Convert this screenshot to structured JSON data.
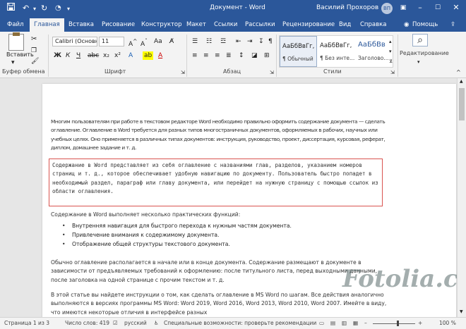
{
  "titlebar": {
    "doc_title": "Документ  -  Word",
    "user_name": "Василий Прохоров",
    "avatar_initials": "ВП",
    "icons": [
      "save-icon",
      "undo-icon",
      "redo-icon",
      "autosave-icon",
      "customize-icon"
    ],
    "window_buttons": [
      "ribbon-display-icon",
      "minimize-icon",
      "maximize-icon",
      "close-icon"
    ]
  },
  "tabs": [
    {
      "label": "Файл"
    },
    {
      "label": "Главная",
      "active": true
    },
    {
      "label": "Вставка"
    },
    {
      "label": "Рисование"
    },
    {
      "label": "Конструктор"
    },
    {
      "label": "Макет"
    },
    {
      "label": "Ссылки"
    },
    {
      "label": "Рассылки"
    },
    {
      "label": "Рецензирование"
    },
    {
      "label": "Вид"
    },
    {
      "label": "Справка"
    }
  ],
  "help_label": "Помощь",
  "ribbon": {
    "paste_label": "Вставить",
    "font_name": "Calibri (Основн",
    "font_size": "11",
    "format_buttons": [
      "Ж",
      "К",
      "Ч",
      "x₂",
      "x²",
      "A"
    ],
    "groups": {
      "clipboard": "Буфер обмена",
      "font": "Шрифт",
      "paragraph": "Абзац",
      "styles": "Стили",
      "editing": "Редактирование"
    },
    "styles": [
      {
        "sample": "АаБбВвГг,",
        "name": "¶ Обычный",
        "selected": true
      },
      {
        "sample": "АаБбВвГг,",
        "name": "¶ Без инте..."
      },
      {
        "sample": "АаБбВв",
        "name": "Заголово..."
      }
    ]
  },
  "document": {
    "para1": "Многим пользователям при работе в текстовом редакторе Word необходимо правильно оформить содержание документа — сделать оглавление. Оглавление в Word требуется для разных типов многостраничных документов, оформляемых в рабочих, научных или учебных целях. Оно применяется в различных типах документов: инструкция, руководство, проект, диссертация, курсовая, реферат, диплом, домашнее задание и т. д.",
    "highlight": "Содержание в Word представляет из себя оглавление с названиями глав, разделов, указанием номеров страниц и т. д., которое обеспечивает удобную навигацию по документу. Пользователь быстро попадет в необходимый раздел, параграф или главу документа, или перейдет на нужную страницу с помощью ссылок из области оглавления.",
    "para2": "Содержание в Word выполняет несколько практических функций:",
    "bullets": [
      "Внутренняя навигация для быстрого перехода к нужным частям документа.",
      "Привлечение внимания к содержимому документа.",
      "Отображение общей структуры текстового документа."
    ],
    "para3": "Обычно оглавление располагается в начале или в конце документа. Содержание размещают в документе в зависимости от предъявляемых требований к оформлению: после титульного листа, перед выходными данными, после заголовка на одной странице с прочим текстом и т. д.",
    "para4": "В этой статье вы найдете инструкции о том, как сделать оглавление в MS Word по шагам. Все действия аналогично выполняются в версиях программы MS Word: Word 2019, Word 2016, Word 2013, Word 2010, Word 2007. Имейте в виду, что имеются некоторые отличия в интерфейсе разных"
  },
  "watermark": "Fotolia.com",
  "status": {
    "page": "Страница 1 из 3",
    "words": "Число слов: 419",
    "language": "русский",
    "accessibility": "Специальные возможности: проверьте рекомендации",
    "zoom": "100 %",
    "zoom_level": 100
  }
}
